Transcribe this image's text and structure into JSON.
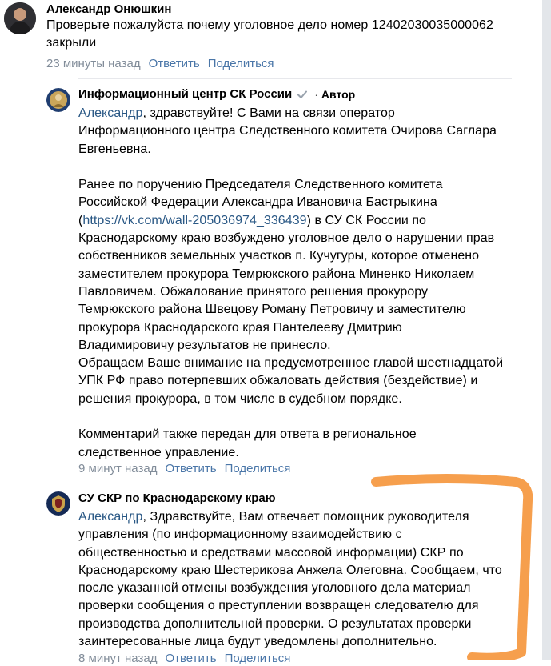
{
  "comments": [
    {
      "author": "Александр Онюшкин",
      "lines": [
        "Проверьте пожалуйста почему уголовное дело номер 12402030035000062",
        "закрыли"
      ],
      "time": "23 минуты назад",
      "reply": "Ответить",
      "share": "Поделиться"
    },
    {
      "author": "Информационный центр СК России",
      "role": "Автор",
      "mention": "Александр",
      "first_line_rest": ", здравствуйте! С Вами на связи оператор",
      "lines_a": [
        "Информационного центра Следственного комитета Очирова Саглара",
        "Евгеньевна."
      ],
      "lines_b": [
        "Ранее по поручению Председателя Следственного комитета",
        "Российской Федерации Александра Ивановича Бастрыкина"
      ],
      "link_open": "(",
      "link": "https://vk.com/wall-205036974_336439",
      "link_rest": ") в СУ СК России по",
      "lines_c": [
        "Краснодарскому краю возбуждено уголовное дело о нарушении прав",
        "собственников земельных участков п. Кучугуры, которое отменено",
        "заместителем прокурора Темрюкского района Миненко Николаем",
        "Павловичем. Обжалование принятого решения прокурору",
        "Темрюкского района Швецову Роману Петровичу и заместителю",
        "прокурора Краснодарского края Пантелееву Дмитрию",
        "Владимировичу результатов не принесло.",
        "Обращаем Ваше внимание на предусмотренное главой шестнадцатой",
        "УПК РФ право потерпевших обжаловать действия (бездействие) и",
        "решения прокурора, в том числе в судебном порядке."
      ],
      "lines_d": [
        "Комментарий также передан для ответа в региональное",
        "следственное управление."
      ],
      "time": "9 минут назад",
      "reply": "Ответить",
      "share": "Поделиться"
    },
    {
      "author": "СУ СКР по Краснодарскому краю",
      "mention": "Александр",
      "first_line_rest": ", Здравствуйте, Вам отвечает помощник руководителя",
      "lines": [
        "управления (по информационному взаимодействию с",
        "общественностью и средствами массовой информации) СКР по",
        "Краснодарскому краю Шестерикова Анжела Олеговна. Сообщаем, что",
        "после указанной отмены возбуждения уголовного дела материал",
        "проверки сообщения о преступлении возвращен следователю для",
        "производства дополнительной проверки. О результатах проверки",
        "заинтересованные лица будут уведомлены дополнительно."
      ],
      "time": "8 минут назад",
      "reply": "Ответить",
      "share": "Поделиться"
    }
  ],
  "colors": {
    "link": "#2a5885",
    "action": "#4a76a8",
    "meta": "#818c99",
    "verified": "#99a2ad",
    "annotation": "#f5953a"
  },
  "icons": [
    "verified-icon"
  ]
}
